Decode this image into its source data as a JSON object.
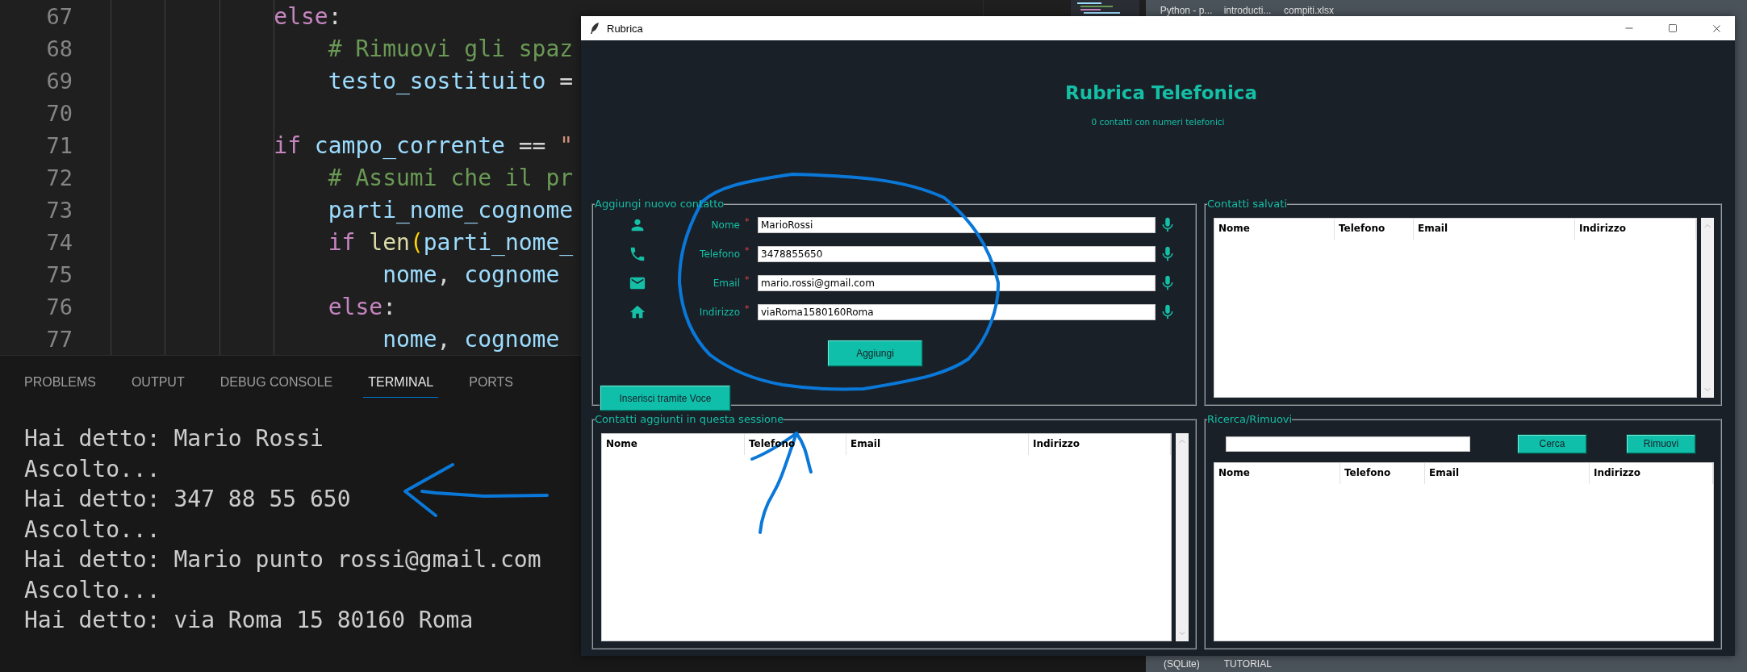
{
  "editor": {
    "lines": [
      {
        "number": "67",
        "segments": [
          {
            "kind": "kw",
            "text": "            else"
          },
          {
            "kind": "plain",
            "text": ":"
          }
        ]
      },
      {
        "number": "68",
        "segments": [
          {
            "kind": "cmt",
            "text": "                # Rimuovi gli spaz"
          }
        ]
      },
      {
        "number": "69",
        "segments": [
          {
            "kind": "var",
            "text": "                testo_sostituito"
          },
          {
            "kind": "plain",
            "text": " ="
          }
        ]
      },
      {
        "number": "70"
      },
      {
        "number": "71",
        "segments": [
          {
            "kind": "kw",
            "text": "            if"
          },
          {
            "kind": "var",
            "text": " campo_corrente"
          },
          {
            "kind": "plain",
            "text": " == "
          },
          {
            "kind": "str",
            "text": "\""
          }
        ]
      },
      {
        "number": "72",
        "segments": [
          {
            "kind": "cmt",
            "text": "                # Assumi che il pr"
          }
        ]
      },
      {
        "number": "73",
        "segments": [
          {
            "kind": "var",
            "text": "                parti_nome_cognome"
          }
        ]
      },
      {
        "number": "74",
        "segments": [
          {
            "kind": "kw",
            "text": "                if"
          },
          {
            "kind": "fn",
            "text": " len"
          },
          {
            "kind": "paren",
            "text": "("
          },
          {
            "kind": "var",
            "text": "parti_nome_"
          }
        ]
      },
      {
        "number": "75",
        "segments": [
          {
            "kind": "var",
            "text": "                    nome"
          },
          {
            "kind": "plain",
            "text": ", "
          },
          {
            "kind": "var",
            "text": "cognome"
          }
        ]
      },
      {
        "number": "76",
        "segments": [
          {
            "kind": "kw",
            "text": "                else"
          },
          {
            "kind": "plain",
            "text": ":"
          }
        ]
      },
      {
        "number": "77",
        "segments": [
          {
            "kind": "var",
            "text": "                    nome"
          },
          {
            "kind": "plain",
            "text": ", "
          },
          {
            "kind": "var",
            "text": "cognome"
          }
        ]
      }
    ]
  },
  "panel": {
    "tabs": [
      {
        "label": "PROBLEMS",
        "selected": false
      },
      {
        "label": "OUTPUT",
        "selected": false
      },
      {
        "label": "DEBUG CONSOLE",
        "selected": false
      },
      {
        "label": "TERMINAL",
        "selected": true
      },
      {
        "label": "PORTS",
        "selected": false
      }
    ],
    "terminal_lines": [
      "Hai detto: Mario Rossi",
      "Ascolto...",
      "Hai detto: 347 88 55 650",
      "Ascolto...",
      "Hai detto: Mario punto rossi@gmail.com",
      "Ascolto...",
      "Hai detto: via Roma 15 80160 Roma"
    ]
  },
  "background_window": {
    "top_items": [
      "Python - p...",
      "introducti...",
      "compiti.xlsx"
    ],
    "bottom_items": [
      "(SQLite)",
      "TUTORIAL"
    ]
  },
  "window": {
    "title": "Rubrica",
    "heading": "Rubrica Telefonica",
    "subtitle": "0 contatti con numeri telefonici",
    "add_contact": {
      "legend": "Aggiungi nuovo contatto",
      "fields": [
        {
          "label": "Nome",
          "required_mark": "*",
          "value": "MarioRossi"
        },
        {
          "label": "Telefono",
          "required_mark": "*",
          "value": "3478855650"
        },
        {
          "label": "Email",
          "required_mark": "*",
          "value": "mario.rossi@gmail.com"
        },
        {
          "label": "Indirizzo",
          "required_mark": "*",
          "value": "viaRoma1580160Roma"
        }
      ],
      "add_button": "Aggiungi",
      "voice_button": "Inserisci tramite Voce"
    },
    "saved_contacts": {
      "legend": "Contatti salvati",
      "columns": [
        "Nome",
        "Telefono",
        "Email",
        "Indirizzo"
      ]
    },
    "session_contacts": {
      "legend": "Contatti aggiunti in questa sessione",
      "columns": [
        "Nome",
        "Telefono",
        "Email",
        "Indirizzo"
      ]
    },
    "search_remove": {
      "legend": "Ricerca/Rimuovi",
      "buttons": [
        "Cerca",
        "Rimuovi"
      ],
      "columns": [
        "Nome",
        "Telefono",
        "Email",
        "Indirizzo"
      ]
    }
  }
}
